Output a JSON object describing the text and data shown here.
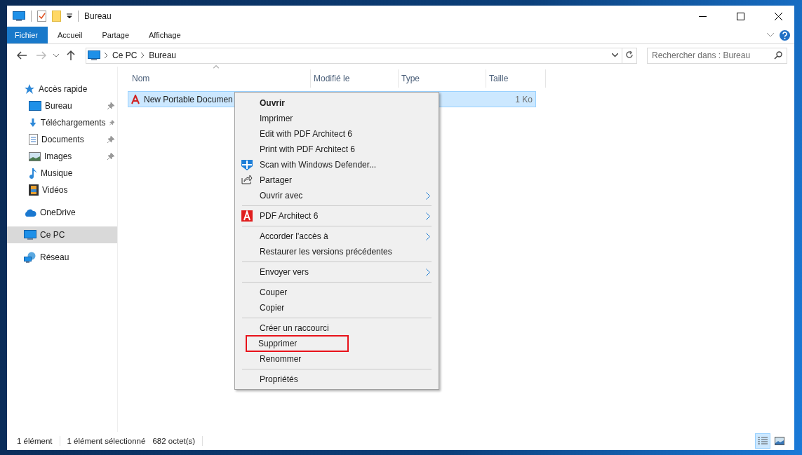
{
  "window": {
    "title": "Bureau"
  },
  "ribbon_tabs": [
    {
      "label": "Fichier",
      "kind": "file"
    },
    {
      "label": "Accueil",
      "kind": "tab"
    },
    {
      "label": "Partage",
      "kind": "tab"
    },
    {
      "label": "Affichage",
      "kind": "tab"
    }
  ],
  "address": {
    "path": [
      "Ce PC",
      "Bureau"
    ]
  },
  "search": {
    "placeholder": "Rechercher dans : Bureau"
  },
  "sidebar": {
    "items": [
      {
        "label": "Accès rapide",
        "kind": "star",
        "selected": false,
        "children": [
          {
            "label": "Bureau",
            "kind": "desktop",
            "pinned": true,
            "selected": false
          },
          {
            "label": "Téléchargements",
            "kind": "download",
            "pinned": true,
            "selected": false
          },
          {
            "label": "Documents",
            "kind": "document",
            "pinned": true,
            "selected": false
          },
          {
            "label": "Images",
            "kind": "picture",
            "pinned": true,
            "selected": false
          },
          {
            "label": "Musique",
            "kind": "music",
            "pinned": false,
            "selected": false
          },
          {
            "label": "Vidéos",
            "kind": "video",
            "pinned": false,
            "selected": false
          }
        ]
      },
      {
        "label": "OneDrive",
        "kind": "cloud",
        "selected": false
      },
      {
        "label": "Ce PC",
        "kind": "pc",
        "selected": true
      },
      {
        "label": "Réseau",
        "kind": "network",
        "selected": false
      }
    ]
  },
  "table": {
    "columns": [
      "Nom",
      "Modifié le",
      "Type",
      "Taille"
    ],
    "rows": [
      {
        "name": "New Portable Documen",
        "size": "1 Ko",
        "selected": true
      }
    ]
  },
  "context_menu": {
    "items": [
      {
        "kind": "item",
        "label": "Ouvrir",
        "default": true,
        "submenu": false,
        "highlighted": false
      },
      {
        "kind": "item",
        "label": "Imprimer",
        "default": false,
        "submenu": false,
        "highlighted": false
      },
      {
        "kind": "item",
        "label": "Edit with PDF Architect 6",
        "default": false,
        "submenu": false,
        "highlighted": false
      },
      {
        "kind": "item",
        "label": "Print with PDF Architect 6",
        "default": false,
        "submenu": false,
        "highlighted": false
      },
      {
        "kind": "scan",
        "label": "Scan with Windows Defender...",
        "default": false,
        "submenu": false,
        "highlighted": false
      },
      {
        "kind": "share",
        "label": "Partager",
        "default": false,
        "submenu": false,
        "highlighted": false
      },
      {
        "kind": "item",
        "label": "Ouvrir avec",
        "default": false,
        "submenu": true,
        "highlighted": false
      },
      {
        "kind": "separator"
      },
      {
        "kind": "app",
        "label": "PDF Architect 6",
        "default": false,
        "submenu": true,
        "highlighted": false
      },
      {
        "kind": "separator"
      },
      {
        "kind": "item",
        "label": "Accorder l'accès à",
        "default": false,
        "submenu": true,
        "highlighted": false
      },
      {
        "kind": "item",
        "label": "Restaurer les versions précédentes",
        "default": false,
        "submenu": false,
        "highlighted": false
      },
      {
        "kind": "separator"
      },
      {
        "kind": "item",
        "label": "Envoyer vers",
        "default": false,
        "submenu": true,
        "highlighted": false
      },
      {
        "kind": "separator"
      },
      {
        "kind": "item",
        "label": "Couper",
        "default": false,
        "submenu": false,
        "highlighted": false
      },
      {
        "kind": "item",
        "label": "Copier",
        "default": false,
        "submenu": false,
        "highlighted": false
      },
      {
        "kind": "separator"
      },
      {
        "kind": "item",
        "label": "Créer un raccourci",
        "default": false,
        "submenu": false,
        "highlighted": false
      },
      {
        "kind": "item",
        "label": "Supprimer",
        "default": false,
        "submenu": false,
        "highlighted": true
      },
      {
        "kind": "item",
        "label": "Renommer",
        "default": false,
        "submenu": false,
        "highlighted": false
      },
      {
        "kind": "separator"
      },
      {
        "kind": "item",
        "label": "Propriétés",
        "default": false,
        "submenu": false,
        "highlighted": false
      }
    ]
  },
  "status_bar": {
    "item_count": "1 élément",
    "selection": "1 élément sélectionné",
    "size": "682 octet(s)",
    "views": [
      {
        "kind": "details",
        "selected": true
      },
      {
        "kind": "large-icons",
        "selected": false
      }
    ]
  }
}
